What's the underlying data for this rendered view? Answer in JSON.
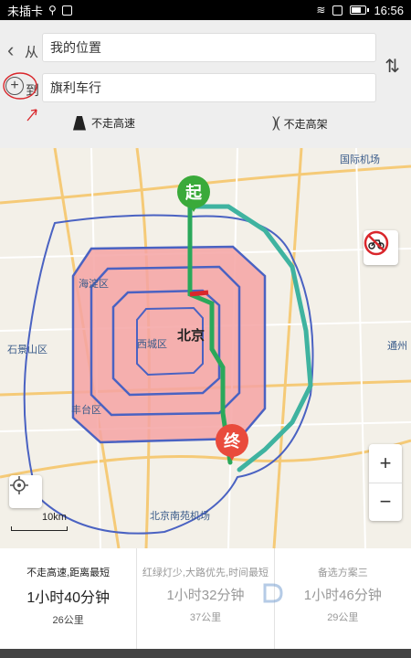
{
  "status_bar": {
    "carrier": "未插卡",
    "time": "16:56"
  },
  "route": {
    "from_label": "从",
    "from_value": "我的位置",
    "to_label": "到",
    "to_value": "旗利车行",
    "options": [
      {
        "label": "不走高速",
        "icon": "no-highway-icon"
      },
      {
        "label": "不走高架",
        "icon": "no-elevated-icon"
      }
    ]
  },
  "map": {
    "city": "北京",
    "labels": [
      {
        "text": "国际机场"
      },
      {
        "text": "海淀区"
      },
      {
        "text": "西城区"
      },
      {
        "text": "石景山区"
      },
      {
        "text": "丰台区"
      },
      {
        "text": "通州"
      },
      {
        "text": "北京南苑机场"
      }
    ],
    "start_marker": "起",
    "end_marker": "终",
    "scale": "10km",
    "zoom_in": "+",
    "zoom_out": "−",
    "colors": {
      "area_fill": "#f5a3a3",
      "area_stroke": "#4a62c2",
      "route_green": "#2aa85a",
      "route_alt": "#3fb3a0",
      "ring_roads": "#4a62c2"
    }
  },
  "plans": [
    {
      "tag": "不走高速,距离最短",
      "time": "1小时40分钟",
      "distance": "26公里",
      "state": "selected"
    },
    {
      "tag": "红绿灯少,大路优先,时间最短",
      "time": "1小时32分钟",
      "distance": "37公里",
      "state": "normal"
    },
    {
      "tag": "备选方案三",
      "time": "1小时46分钟",
      "distance": "29公里",
      "state": "normal"
    }
  ]
}
